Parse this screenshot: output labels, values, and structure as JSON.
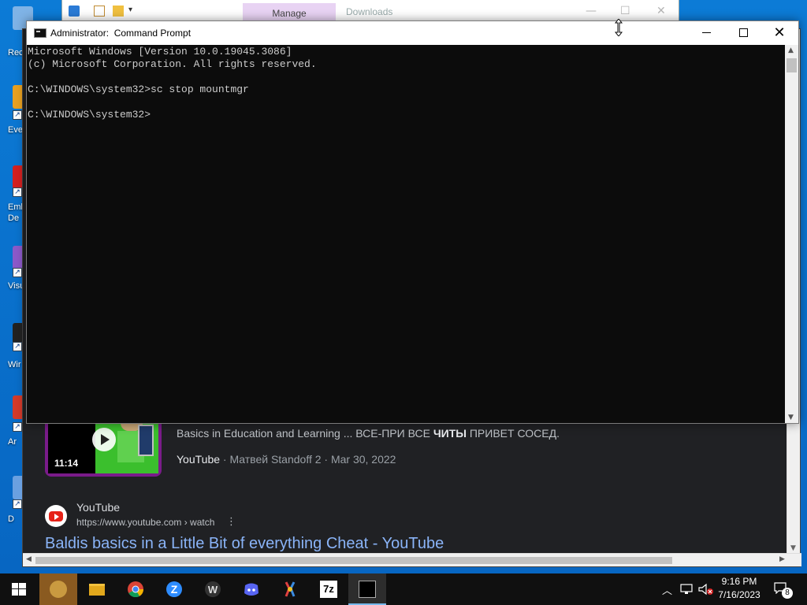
{
  "desktop": {
    "icons": [
      {
        "label": "Rec",
        "icon": "recycle-bin-icon",
        "color": "#7fb3e6"
      },
      {
        "label": "Eve",
        "icon": "app-shortcut-icon",
        "color": "#e8a020"
      },
      {
        "label": "Emb\nDe",
        "icon": "app-shortcut-icon",
        "color": "#d42020"
      },
      {
        "label": "Visu",
        "icon": "visual-studio-icon",
        "color": "#8c59c9"
      },
      {
        "label": "Wir",
        "icon": "app-shortcut-icon",
        "color": "#222222"
      },
      {
        "label": "Ar",
        "icon": "app-shortcut-icon",
        "color": "#d43a2a"
      },
      {
        "label": "D",
        "icon": "app-shortcut-icon",
        "color": "#6aa0e0"
      }
    ]
  },
  "explorer": {
    "manage_tab": "Manage",
    "title": "Downloads"
  },
  "browser": {
    "video_result": {
      "duration": "11:14",
      "snippet_before": "Basics in Education and Learning ... ВСЕ-ПРИ ВСЕ ",
      "snippet_bold": "ЧИТЫ",
      "snippet_after": " ПРИВЕТ СОСЕД.",
      "source": "YouTube",
      "meta": " · Матвей Standoff 2 · Mar 30, 2022"
    },
    "web_result": {
      "site_name": "YouTube",
      "url": "https://www.youtube.com › watch",
      "title": "Baldis basics in a Little Bit of everything Cheat - YouTube"
    }
  },
  "cmd": {
    "title": "Administrator:  Command Prompt",
    "lines": [
      "Microsoft Windows [Version 10.0.19045.3086]",
      "(c) Microsoft Corporation. All rights reserved.",
      "",
      "C:\\WINDOWS\\system32>sc stop mountmgr",
      "",
      "C:\\WINDOWS\\system32>"
    ]
  },
  "taskbar": {
    "apps": [
      {
        "name": "start-button",
        "icon": "windows-logo-icon"
      },
      {
        "name": "taskbar-bonzi",
        "icon": "bonzi-icon"
      },
      {
        "name": "taskbar-file-explorer",
        "icon": "folder-icon"
      },
      {
        "name": "taskbar-chrome",
        "icon": "chrome-icon"
      },
      {
        "name": "taskbar-zoom",
        "icon": "zoom-icon"
      },
      {
        "name": "taskbar-winrar",
        "icon": "winrar-icon"
      },
      {
        "name": "taskbar-discord",
        "icon": "discord-icon"
      },
      {
        "name": "taskbar-tool",
        "icon": "tool-icon"
      },
      {
        "name": "taskbar-7zip",
        "icon": "7zip-icon"
      },
      {
        "name": "taskbar-cmd",
        "icon": "cmd-icon"
      }
    ],
    "seven_zip_label": "7z",
    "time": "9:16 PM",
    "date": "7/16/2023",
    "notification_count": "8"
  },
  "colors": {
    "desktop_bg": "#0a78d4",
    "console_bg": "#0c0c0c",
    "console_text": "#cccccc",
    "link_blue": "#8ab4f8",
    "browser_bg": "#202124",
    "taskbar_bg": "#101010"
  }
}
